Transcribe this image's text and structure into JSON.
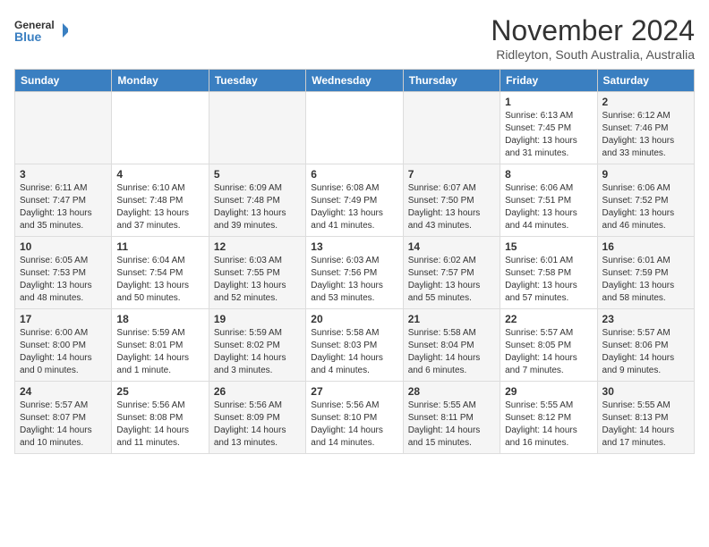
{
  "header": {
    "logo_line1": "General",
    "logo_line2": "Blue",
    "month": "November 2024",
    "location": "Ridleyton, South Australia, Australia"
  },
  "weekdays": [
    "Sunday",
    "Monday",
    "Tuesday",
    "Wednesday",
    "Thursday",
    "Friday",
    "Saturday"
  ],
  "weeks": [
    [
      {
        "day": "",
        "info": ""
      },
      {
        "day": "",
        "info": ""
      },
      {
        "day": "",
        "info": ""
      },
      {
        "day": "",
        "info": ""
      },
      {
        "day": "",
        "info": ""
      },
      {
        "day": "1",
        "info": "Sunrise: 6:13 AM\nSunset: 7:45 PM\nDaylight: 13 hours\nand 31 minutes."
      },
      {
        "day": "2",
        "info": "Sunrise: 6:12 AM\nSunset: 7:46 PM\nDaylight: 13 hours\nand 33 minutes."
      }
    ],
    [
      {
        "day": "3",
        "info": "Sunrise: 6:11 AM\nSunset: 7:47 PM\nDaylight: 13 hours\nand 35 minutes."
      },
      {
        "day": "4",
        "info": "Sunrise: 6:10 AM\nSunset: 7:48 PM\nDaylight: 13 hours\nand 37 minutes."
      },
      {
        "day": "5",
        "info": "Sunrise: 6:09 AM\nSunset: 7:48 PM\nDaylight: 13 hours\nand 39 minutes."
      },
      {
        "day": "6",
        "info": "Sunrise: 6:08 AM\nSunset: 7:49 PM\nDaylight: 13 hours\nand 41 minutes."
      },
      {
        "day": "7",
        "info": "Sunrise: 6:07 AM\nSunset: 7:50 PM\nDaylight: 13 hours\nand 43 minutes."
      },
      {
        "day": "8",
        "info": "Sunrise: 6:06 AM\nSunset: 7:51 PM\nDaylight: 13 hours\nand 44 minutes."
      },
      {
        "day": "9",
        "info": "Sunrise: 6:06 AM\nSunset: 7:52 PM\nDaylight: 13 hours\nand 46 minutes."
      }
    ],
    [
      {
        "day": "10",
        "info": "Sunrise: 6:05 AM\nSunset: 7:53 PM\nDaylight: 13 hours\nand 48 minutes."
      },
      {
        "day": "11",
        "info": "Sunrise: 6:04 AM\nSunset: 7:54 PM\nDaylight: 13 hours\nand 50 minutes."
      },
      {
        "day": "12",
        "info": "Sunrise: 6:03 AM\nSunset: 7:55 PM\nDaylight: 13 hours\nand 52 minutes."
      },
      {
        "day": "13",
        "info": "Sunrise: 6:03 AM\nSunset: 7:56 PM\nDaylight: 13 hours\nand 53 minutes."
      },
      {
        "day": "14",
        "info": "Sunrise: 6:02 AM\nSunset: 7:57 PM\nDaylight: 13 hours\nand 55 minutes."
      },
      {
        "day": "15",
        "info": "Sunrise: 6:01 AM\nSunset: 7:58 PM\nDaylight: 13 hours\nand 57 minutes."
      },
      {
        "day": "16",
        "info": "Sunrise: 6:01 AM\nSunset: 7:59 PM\nDaylight: 13 hours\nand 58 minutes."
      }
    ],
    [
      {
        "day": "17",
        "info": "Sunrise: 6:00 AM\nSunset: 8:00 PM\nDaylight: 14 hours\nand 0 minutes."
      },
      {
        "day": "18",
        "info": "Sunrise: 5:59 AM\nSunset: 8:01 PM\nDaylight: 14 hours\nand 1 minute."
      },
      {
        "day": "19",
        "info": "Sunrise: 5:59 AM\nSunset: 8:02 PM\nDaylight: 14 hours\nand 3 minutes."
      },
      {
        "day": "20",
        "info": "Sunrise: 5:58 AM\nSunset: 8:03 PM\nDaylight: 14 hours\nand 4 minutes."
      },
      {
        "day": "21",
        "info": "Sunrise: 5:58 AM\nSunset: 8:04 PM\nDaylight: 14 hours\nand 6 minutes."
      },
      {
        "day": "22",
        "info": "Sunrise: 5:57 AM\nSunset: 8:05 PM\nDaylight: 14 hours\nand 7 minutes."
      },
      {
        "day": "23",
        "info": "Sunrise: 5:57 AM\nSunset: 8:06 PM\nDaylight: 14 hours\nand 9 minutes."
      }
    ],
    [
      {
        "day": "24",
        "info": "Sunrise: 5:57 AM\nSunset: 8:07 PM\nDaylight: 14 hours\nand 10 minutes."
      },
      {
        "day": "25",
        "info": "Sunrise: 5:56 AM\nSunset: 8:08 PM\nDaylight: 14 hours\nand 11 minutes."
      },
      {
        "day": "26",
        "info": "Sunrise: 5:56 AM\nSunset: 8:09 PM\nDaylight: 14 hours\nand 13 minutes."
      },
      {
        "day": "27",
        "info": "Sunrise: 5:56 AM\nSunset: 8:10 PM\nDaylight: 14 hours\nand 14 minutes."
      },
      {
        "day": "28",
        "info": "Sunrise: 5:55 AM\nSunset: 8:11 PM\nDaylight: 14 hours\nand 15 minutes."
      },
      {
        "day": "29",
        "info": "Sunrise: 5:55 AM\nSunset: 8:12 PM\nDaylight: 14 hours\nand 16 minutes."
      },
      {
        "day": "30",
        "info": "Sunrise: 5:55 AM\nSunset: 8:13 PM\nDaylight: 14 hours\nand 17 minutes."
      }
    ]
  ]
}
